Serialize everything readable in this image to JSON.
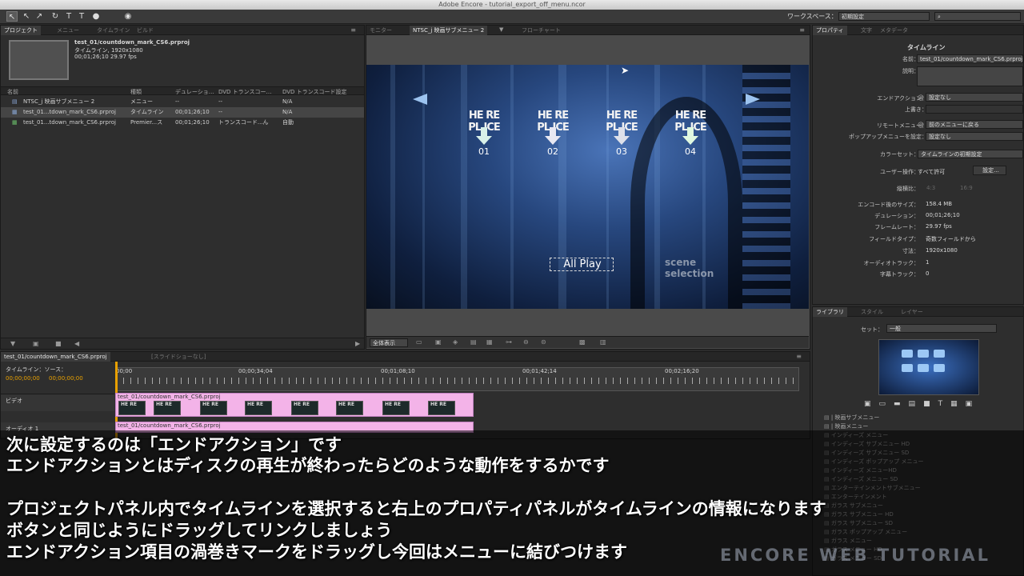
{
  "app": {
    "window_title": "Adobe Encore - tutorial_export_off_menu.ncor"
  },
  "workspace": {
    "label": "ワークスペース：",
    "value": "初期設定"
  },
  "project_panel": {
    "tabs": [
      "プロジェクト",
      "メニュー",
      "タイムライン",
      "ビルド"
    ],
    "preview": {
      "name": "test_01/countdown_mark_CS6.prproj",
      "line2": "タイムライン, 1920x1080",
      "line3": "00;01;26;10 29.97 fps"
    },
    "columns": [
      "名前",
      "種類",
      "デュレーショ…",
      "DVD トランスコー…",
      "DVD トランスコード設定"
    ],
    "rows": [
      {
        "name": "NTSC_j 映画サブメニュー 2",
        "type": "メニュー",
        "duration": "--",
        "dvd_transcode": "--",
        "dvd_setting": "N/A"
      },
      {
        "name": "test_01...tdown_mark_CS6.prproj",
        "type": "タイムライン",
        "duration": "00;01;26;10",
        "dvd_transcode": "--",
        "dvd_setting": "N/A"
      },
      {
        "name": "test_01...tdown_mark_CS6.prproj",
        "type": "Premier...ス",
        "duration": "00;01;26;10",
        "dvd_transcode": "トランスコード...ん",
        "dvd_setting": "自動"
      }
    ]
  },
  "monitor_panel": {
    "tabs": [
      "モニター",
      "NTSC_j 映画サブメニュー 2",
      "フローチャート"
    ],
    "buttons": [
      {
        "text_top": "HE RE",
        "text_bottom": "PL ICE",
        "number": "01",
        "arrow_color": "#d8f0e8"
      },
      {
        "text_top": "HE RE",
        "text_bottom": "PL ICE",
        "number": "02",
        "arrow_color": "#e8e8f2"
      },
      {
        "text_top": "HE RE",
        "text_bottom": "PL ICE",
        "number": "03",
        "arrow_color": "#dde0ea"
      },
      {
        "text_top": "HE RE",
        "text_bottom": "PL ICE",
        "number": "04",
        "arrow_color": "#e0f8e0"
      }
    ],
    "all_play": "All Play",
    "scene_line1": "scene",
    "scene_line2": "selection",
    "zoom": "全体表示"
  },
  "properties_panel": {
    "tabs": [
      "プロパティ",
      "文字",
      "メタデータ"
    ],
    "heading": "タイムライン",
    "name_label": "名前：",
    "name_value": "test_01/countdown_mark_CS6.prproj",
    "desc_label": "説明：",
    "end_action_label": "エンドアクション：",
    "end_action_value": "設定なし",
    "override_label": "上書き：",
    "remote_label": "リモートメニュー：",
    "remote_value": "前のメニューに戻る",
    "popup_label": "ポップアップメニューを設定：",
    "popup_value": "設定なし",
    "colorset_label": "カラーセット：",
    "colorset_value": "タイムラインの初期設定",
    "user_ops_label": "ユーザー操作：",
    "user_ops_value": "すべて許可",
    "settings_button": "設定...",
    "aspect_label": "縦横比：",
    "aspect_a": "4:3",
    "aspect_b": "16:9",
    "encoded_label": "エンコード後のサイズ：",
    "encoded_value": "158.4 MB",
    "duration_label": "デュレーション：",
    "duration_value": "00;01;26;10",
    "framerate_label": "フレームレート：",
    "framerate_value": "29.97 fps",
    "field_label": "フィールドタイプ：",
    "field_value": "奇数フィールドから",
    "dims_label": "寸法：",
    "dims_value": "1920x1080",
    "audio_label": "オーディオトラック：",
    "audio_value": "1",
    "subtitle_label": "字幕トラック：",
    "subtitle_value": "0"
  },
  "library_panel": {
    "tabs": [
      "ライブラリ",
      "スタイル",
      "レイヤー"
    ],
    "set_label": "セット：",
    "set_value": "一般",
    "items": [
      "| 映画サブメニュー",
      "| 映画メニュー",
      "インディーズ メニュー",
      "インディーズ サブメニュー HD",
      "インディーズ サブメニュー SD",
      "インディーズ ポップアップ メニュー",
      "インディーズ メニューHD",
      "インディーズ メニュー SD",
      "エンターテインメントサブメニュー",
      "エンターテインメント",
      "ガラス サブメニュー",
      "ガラス サブメニュー HD",
      "ガラス サブメニュー SD",
      "ガラス ポップアップ メニュー",
      "ガラス メニュー",
      "ガラス メニュー HD",
      "ガラス メニュー SD"
    ]
  },
  "timeline_panel": {
    "tabs": [
      "test_01/countdown_mark_CS6.prproj",
      "[スライドショーなし]"
    ],
    "label": "タイムライン：ソース：",
    "timecode_a": "00;00;00;00",
    "timecode_b": "00;00;00;00",
    "ruler": [
      "00;00",
      "00;00;34;04",
      "00;01;08;10",
      "00;01;42;14",
      "00;02;16;20"
    ],
    "video_label": "ビデオ",
    "audio_label": "オーディオ 1",
    "clip_name": "test_01/countdown_mark_CS6.prproj"
  },
  "subtitles": [
    "次に設定するのは「エンドアクション」です",
    "エンドアクションとはディスクの再生が終わったらどのような動作をするかです",
    "プロジェクトパネル内でタイムラインを選択すると右上のプロパティパネルがタイムラインの情報になります",
    "ボタンと同じようにドラッグしてリンクしましょう",
    "エンドアクション項目の渦巻きマークをドラッグし今回はメニューに結びつけます"
  ],
  "watermark": "ENCORE WEB TUTORIAL",
  "colors": {
    "accent_orange": "#e8a000",
    "clip_pink": "#f3b3e8",
    "panel_bg": "#2e2e2e"
  }
}
